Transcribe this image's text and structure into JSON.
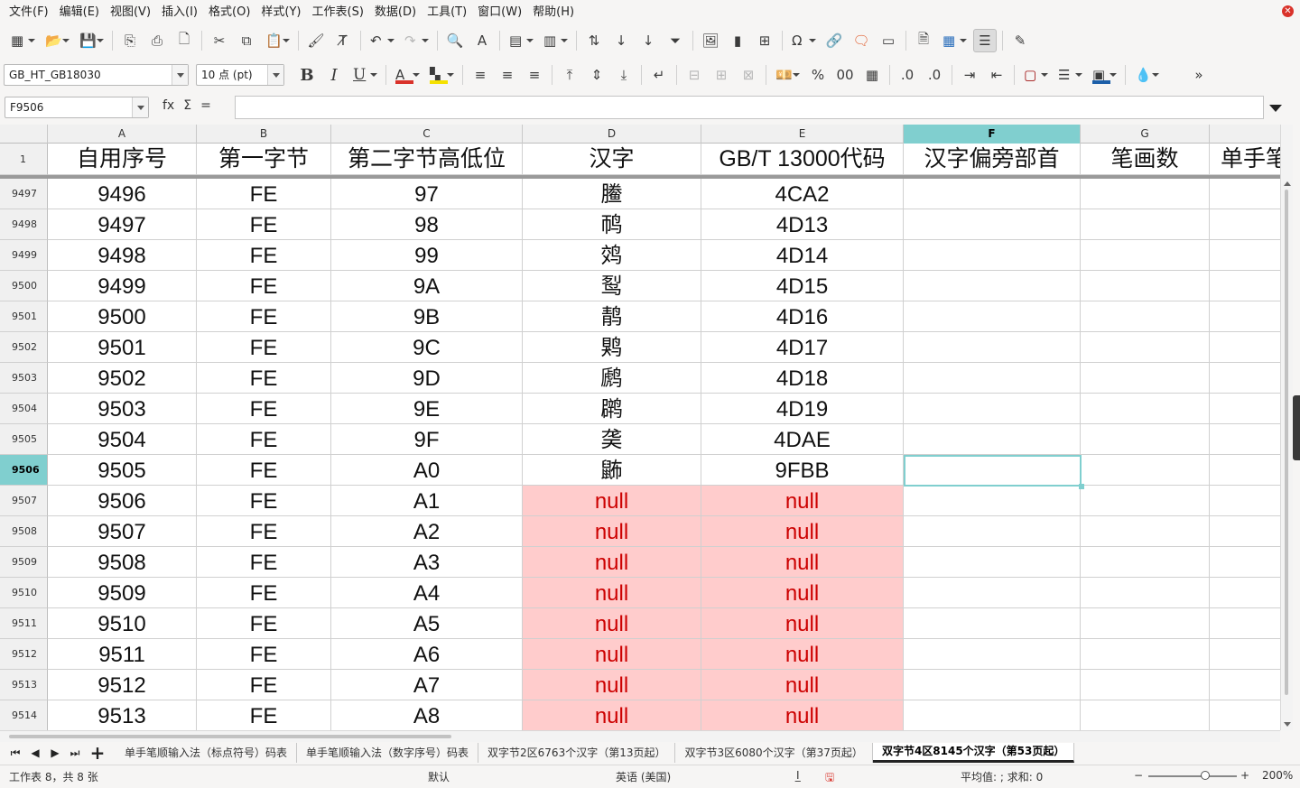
{
  "menu": [
    "文件(F)",
    "编辑(E)",
    "视图(V)",
    "插入(I)",
    "格式(O)",
    "样式(Y)",
    "工作表(S)",
    "数据(D)",
    "工具(T)",
    "窗口(W)",
    "帮助(H)"
  ],
  "toolbar2": {
    "font_name": "GB_HT_GB18030",
    "font_size": "10 点 (pt)",
    "percent_glyph": "%",
    "font_color": "#d9322a",
    "highlight_color": "#f5e100",
    "border_color": "#1c5fa8"
  },
  "formula_bar": {
    "name_box": "F9506",
    "formula": "",
    "fx": "fx",
    "sum": "Σ",
    "equals": "="
  },
  "columns": [
    {
      "letter": "A",
      "header": "自用序号"
    },
    {
      "letter": "B",
      "header": "第一字节"
    },
    {
      "letter": "C",
      "header": "第二字节高低位"
    },
    {
      "letter": "D",
      "header": "汉字"
    },
    {
      "letter": "E",
      "header": "GB/T  13000代码"
    },
    {
      "letter": "F",
      "header": "汉字偏旁部首"
    },
    {
      "letter": "G",
      "header": "笔画数"
    },
    {
      "letter": "",
      "header": "单手笔"
    }
  ],
  "header_row_label": "1",
  "rows": [
    {
      "row": "9497",
      "a": "9496",
      "b": "FE",
      "c": "97",
      "d": "䲢",
      "e": "4CA2"
    },
    {
      "row": "9498",
      "a": "9497",
      "b": "FE",
      "c": "98",
      "d": "䴓",
      "e": "4D13"
    },
    {
      "row": "9499",
      "a": "9498",
      "b": "FE",
      "c": "99",
      "d": "䴔",
      "e": "4D14"
    },
    {
      "row": "9500",
      "a": "9499",
      "b": "FE",
      "c": "9A",
      "d": "䴕",
      "e": "4D15"
    },
    {
      "row": "9501",
      "a": "9500",
      "b": "FE",
      "c": "9B",
      "d": "䴖",
      "e": "4D16"
    },
    {
      "row": "9502",
      "a": "9501",
      "b": "FE",
      "c": "9C",
      "d": "䴗",
      "e": "4D17"
    },
    {
      "row": "9503",
      "a": "9502",
      "b": "FE",
      "c": "9D",
      "d": "䴘",
      "e": "4D18"
    },
    {
      "row": "9504",
      "a": "9503",
      "b": "FE",
      "c": "9E",
      "d": "䴙",
      "e": "4D19"
    },
    {
      "row": "9505",
      "a": "9504",
      "b": "FE",
      "c": "9F",
      "d": "䶮",
      "e": "4DAE"
    },
    {
      "row": "9506",
      "a": "9505",
      "b": "FE",
      "c": "A0",
      "d": "鿻",
      "e": "9FBB"
    },
    {
      "row": "9507",
      "a": "9506",
      "b": "FE",
      "c": "A1",
      "d": "null",
      "e": "null"
    },
    {
      "row": "9508",
      "a": "9507",
      "b": "FE",
      "c": "A2",
      "d": "null",
      "e": "null"
    },
    {
      "row": "9509",
      "a": "9508",
      "b": "FE",
      "c": "A3",
      "d": "null",
      "e": "null"
    },
    {
      "row": "9510",
      "a": "9509",
      "b": "FE",
      "c": "A4",
      "d": "null",
      "e": "null"
    },
    {
      "row": "9511",
      "a": "9510",
      "b": "FE",
      "c": "A5",
      "d": "null",
      "e": "null"
    },
    {
      "row": "9512",
      "a": "9511",
      "b": "FE",
      "c": "A6",
      "d": "null",
      "e": "null"
    },
    {
      "row": "9513",
      "a": "9512",
      "b": "FE",
      "c": "A7",
      "d": "null",
      "e": "null"
    },
    {
      "row": "9514",
      "a": "9513",
      "b": "FE",
      "c": "A8",
      "d": "null",
      "e": "null"
    }
  ],
  "selected_cell": {
    "column": "F",
    "row": "9506"
  },
  "sheet_tabs": [
    {
      "label": "单手笔顺输入法（标点符号）码表",
      "active": false
    },
    {
      "label": "单手笔顺输入法（数字序号）码表",
      "active": false
    },
    {
      "label": "双字节2区6763个汉字（第13页起）",
      "active": false
    },
    {
      "label": "双字节3区6080个汉字（第37页起）",
      "active": false
    },
    {
      "label": "双字节4区8145个汉字（第53页起）",
      "active": true
    }
  ],
  "status": {
    "sheet_info": "工作表 8，共 8 张",
    "page_style": "默认",
    "language": "英语 (美国)",
    "summary": "平均值: ; 求和: 0",
    "zoom": "200%",
    "zoom_minus": "−",
    "zoom_plus": "+"
  },
  "colors": {
    "selection": "#80cfcf",
    "null_fill": "#ffcccc",
    "null_text": "#cc0000"
  }
}
